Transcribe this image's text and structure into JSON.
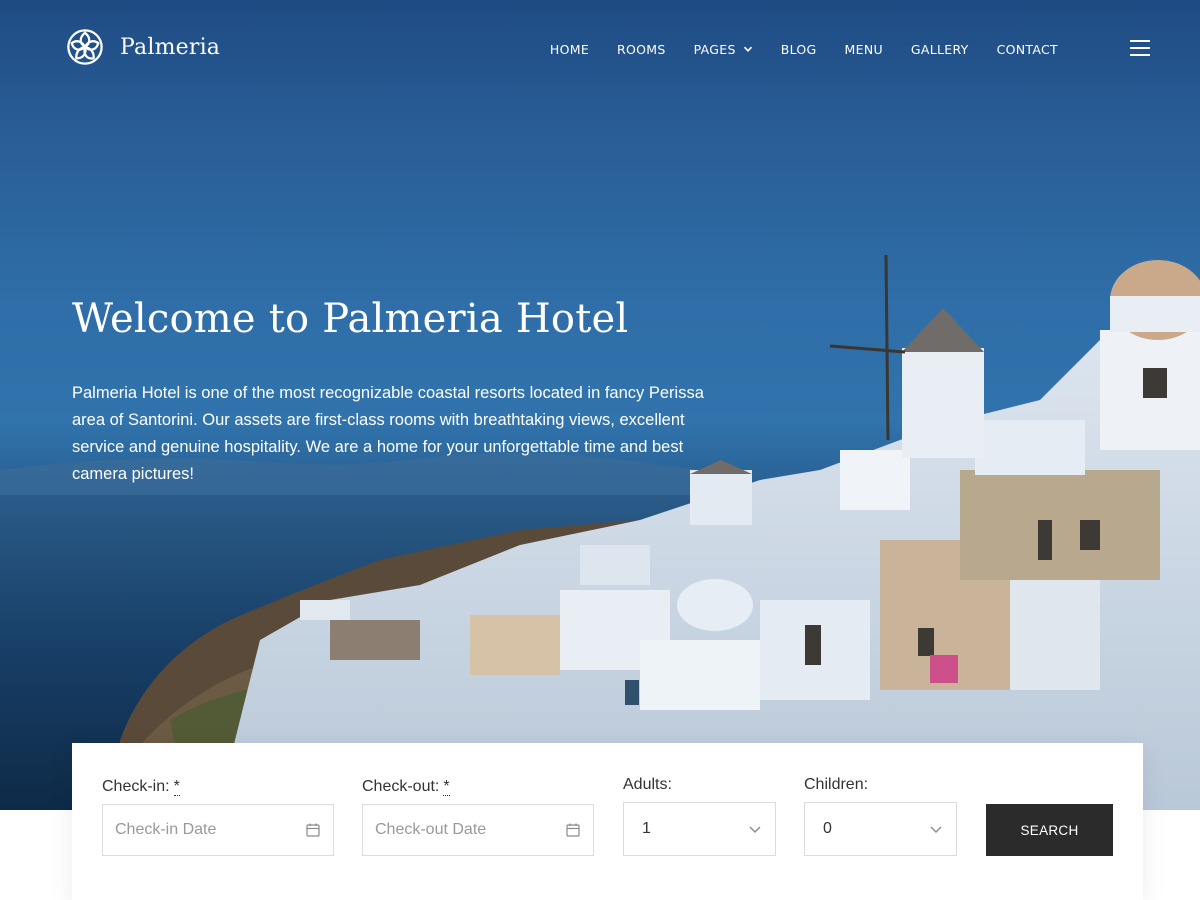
{
  "brand": {
    "name": "Palmeria",
    "logo_icon": "flower-logo-icon"
  },
  "nav": {
    "items": [
      {
        "label": "HOME"
      },
      {
        "label": "ROOMS"
      },
      {
        "label": "PAGES",
        "has_dropdown": true
      },
      {
        "label": "BLOG"
      },
      {
        "label": "MENU"
      },
      {
        "label": "GALLERY"
      },
      {
        "label": "CONTACT"
      }
    ],
    "menu_icon": "hamburger-icon"
  },
  "hero": {
    "title": "Welcome to Palmeria Hotel",
    "description": "Palmeria Hotel is one of the most recognizable coastal resorts located in fancy Perissa area of Santorini. Our assets are first-class rooms with breathtaking views, excellent service and genuine hospitality. We are a home for your unforgettable time and best camera pictures!",
    "background_image": "santorini-coastline-photo"
  },
  "booking": {
    "check_in": {
      "label": "Check-in:",
      "required_mark": "*",
      "placeholder": "Check-in Date",
      "icon": "calendar-icon"
    },
    "check_out": {
      "label": "Check-out:",
      "required_mark": "*",
      "placeholder": "Check-out Date",
      "icon": "calendar-icon"
    },
    "adults": {
      "label": "Adults:",
      "value": "1",
      "icon": "chevron-down-icon"
    },
    "children": {
      "label": "Children:",
      "value": "0",
      "icon": "chevron-down-icon"
    },
    "search_label": "SEARCH"
  },
  "colors": {
    "header_text": "#ffffff",
    "button_bg": "#2b2b2b",
    "sky": "#2f6ea8",
    "sea": "#163a60"
  }
}
